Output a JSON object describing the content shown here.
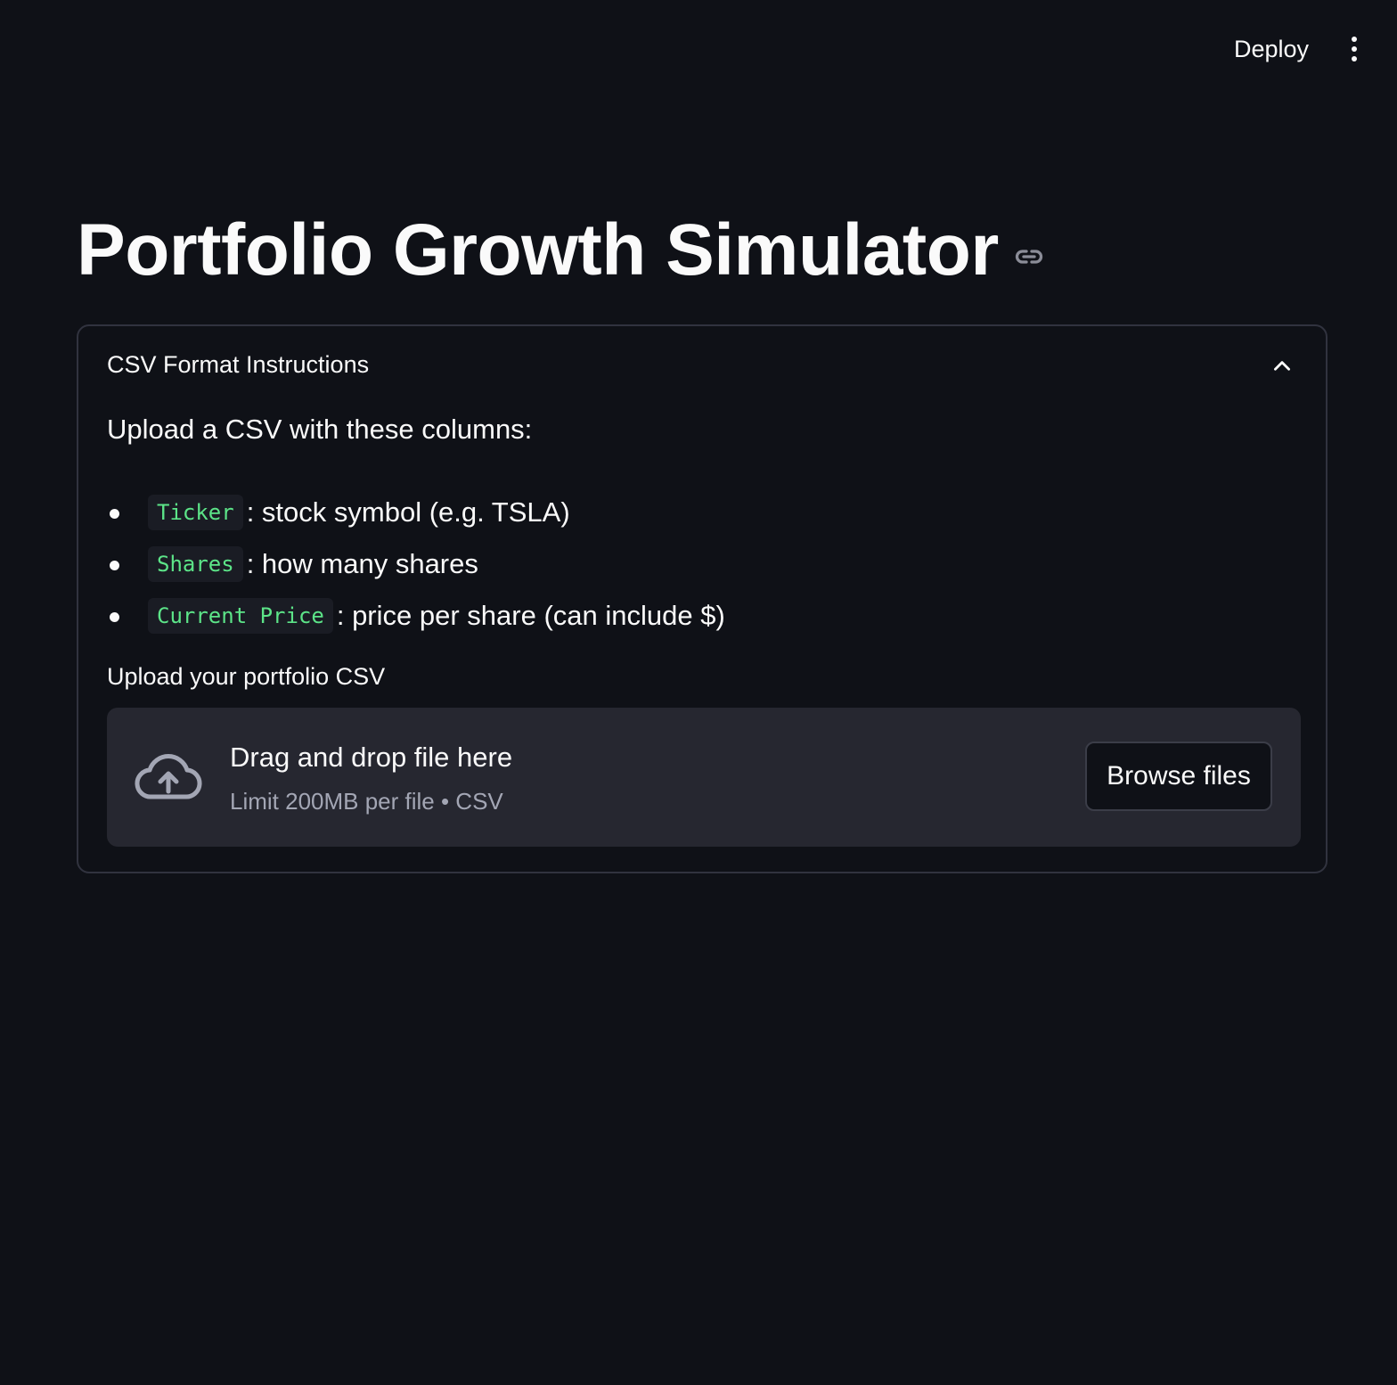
{
  "toolbar": {
    "deploy_label": "Deploy",
    "menu_icon": "more-vertical-icon"
  },
  "header": {
    "title": "Portfolio Growth Simulator",
    "anchor_icon": "link-icon"
  },
  "expander": {
    "title": "CSV Format Instructions",
    "state": "expanded",
    "intro": "Upload a CSV with these columns:",
    "columns": [
      {
        "code": "Ticker",
        "description": ": stock symbol (e.g. TSLA)"
      },
      {
        "code": "Shares",
        "description": ": how many shares"
      },
      {
        "code": "Current Price",
        "description": ": price per share (can include $)"
      }
    ],
    "uploader": {
      "label": "Upload your portfolio CSV",
      "drop_title": "Drag and drop file here",
      "drop_limit": "Limit 200MB per file • CSV",
      "browse_label": "Browse files",
      "icon": "cloud-upload-icon"
    }
  },
  "colors": {
    "background": "#0f1117",
    "text": "#fafafa",
    "code_text": "#5ce488",
    "dropzone": "#262730",
    "border": "#31333f"
  }
}
